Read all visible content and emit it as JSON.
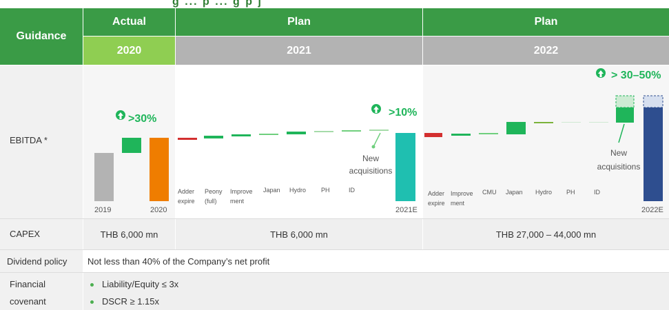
{
  "title_partial": "g   ...   p    ...   g   p  j",
  "header": {
    "guidance": "Guidance",
    "actual": "Actual",
    "plan_1": "Plan",
    "plan_2": "Plan",
    "year_2020": "2020",
    "year_2021": "2021",
    "year_2022": "2022"
  },
  "rows": {
    "ebitda": "EBITDA *",
    "capex": "CAPEX",
    "dividend": "Dividend policy",
    "covenant_line1": "Financial",
    "covenant_line2": "covenant"
  },
  "capex": {
    "c2020": "THB 6,000 mn",
    "c2021": "THB 6,000 mn",
    "c2022": "THB 27,000 – 44,000 mn"
  },
  "dividend_text": "Not less than 40% of the Company’s net profit",
  "covenants": [
    "Liability/Equity ≤ 3x",
    "DSCR ≥ 1.15x"
  ],
  "growth": {
    "g2020": ">30%",
    "g2021": ">10%",
    "g2022": "> 30–50%"
  },
  "annotations": {
    "new_acq_1": "New acquisitions",
    "new_acq_2": "New acquisitions"
  },
  "chart_data": {
    "type": "bar",
    "title": "",
    "segments": [
      {
        "year": "2020",
        "labels": [
          "2019",
          "2020"
        ],
        "bars": [
          {
            "label": "2019",
            "kind": "total",
            "color": "#b3b3b3"
          },
          {
            "label": "",
            "kind": "increase",
            "color": "#1fb55a"
          },
          {
            "label": "2020",
            "kind": "total",
            "color": "#ef7d00"
          }
        ]
      },
      {
        "year": "2021",
        "labels": [
          "Adder expire",
          "Peony (full)",
          "Improve ment",
          "Japan",
          "Hydro",
          "PH",
          "ID",
          "2021E"
        ],
        "bars": [
          {
            "label": "Adder expire",
            "kind": "decrease",
            "color": "#d32f2f"
          },
          {
            "label": "Peony (full)",
            "kind": "increase",
            "color": "#1fb55a"
          },
          {
            "label": "Improve ment",
            "kind": "increase",
            "color": "#1fb55a"
          },
          {
            "label": "Japan",
            "kind": "increase",
            "color": "#1fb55a"
          },
          {
            "label": "Hydro",
            "kind": "increase",
            "color": "#1fb55a"
          },
          {
            "label": "PH",
            "kind": "increase",
            "color": "#1fb55a"
          },
          {
            "label": "ID",
            "kind": "increase",
            "color": "#1fb55a"
          },
          {
            "label": "New acquisitions",
            "kind": "increase",
            "color": "#1fb55a"
          },
          {
            "label": "2021E",
            "kind": "total",
            "color": "#1fbfb0"
          }
        ]
      },
      {
        "year": "2022",
        "labels": [
          "Adder expire",
          "Improve ment",
          "CMU",
          "Japan",
          "Hydro",
          "PH",
          "ID",
          "2022E"
        ],
        "bars": [
          {
            "label": "Adder expire",
            "kind": "decrease",
            "color": "#d32f2f"
          },
          {
            "label": "Improve ment",
            "kind": "increase",
            "color": "#1fb55a"
          },
          {
            "label": "CMU",
            "kind": "increase",
            "color": "#1fb55a"
          },
          {
            "label": "Japan",
            "kind": "increase",
            "color": "#1fb55a"
          },
          {
            "label": "Hydro",
            "kind": "increase",
            "color": "#1fb55a"
          },
          {
            "label": "PH",
            "kind": "increase",
            "color": "#1fb55a"
          },
          {
            "label": "ID",
            "kind": "increase",
            "color": "#1fb55a"
          },
          {
            "label": "New acquisitions",
            "kind": "increase",
            "color": "#1fb55a"
          },
          {
            "label": "2022E",
            "kind": "total",
            "color": "#2e4e8f"
          }
        ]
      }
    ]
  }
}
